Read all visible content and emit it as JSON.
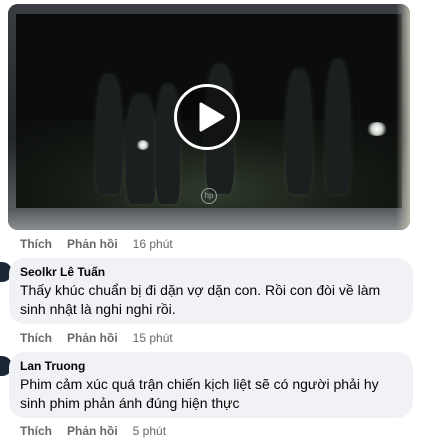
{
  "video": {
    "logo": "hp",
    "play_icon": "play-icon"
  },
  "post_actions": {
    "like": "Thích",
    "reply": "Phản hồi",
    "time": "16 phút"
  },
  "comments": [
    {
      "author": "Seolkr Lê Tuấn",
      "text": "Thấy khúc chuẩn bị đi dặn vợ dặn con. Rồi con đòi về làm sinh nhật là nghi nghi rồi.",
      "like": "Thích",
      "reply": "Phản hồi",
      "time": "15 phút"
    },
    {
      "author": "Lan Truong",
      "text": "Phim cảm xúc quá trận chiến kịch liệt sẽ có người phải hy sinh phim phản ánh đúng hiện thực",
      "like": "Thích",
      "reply": "Phản hồi",
      "time": "5 phút"
    }
  ]
}
